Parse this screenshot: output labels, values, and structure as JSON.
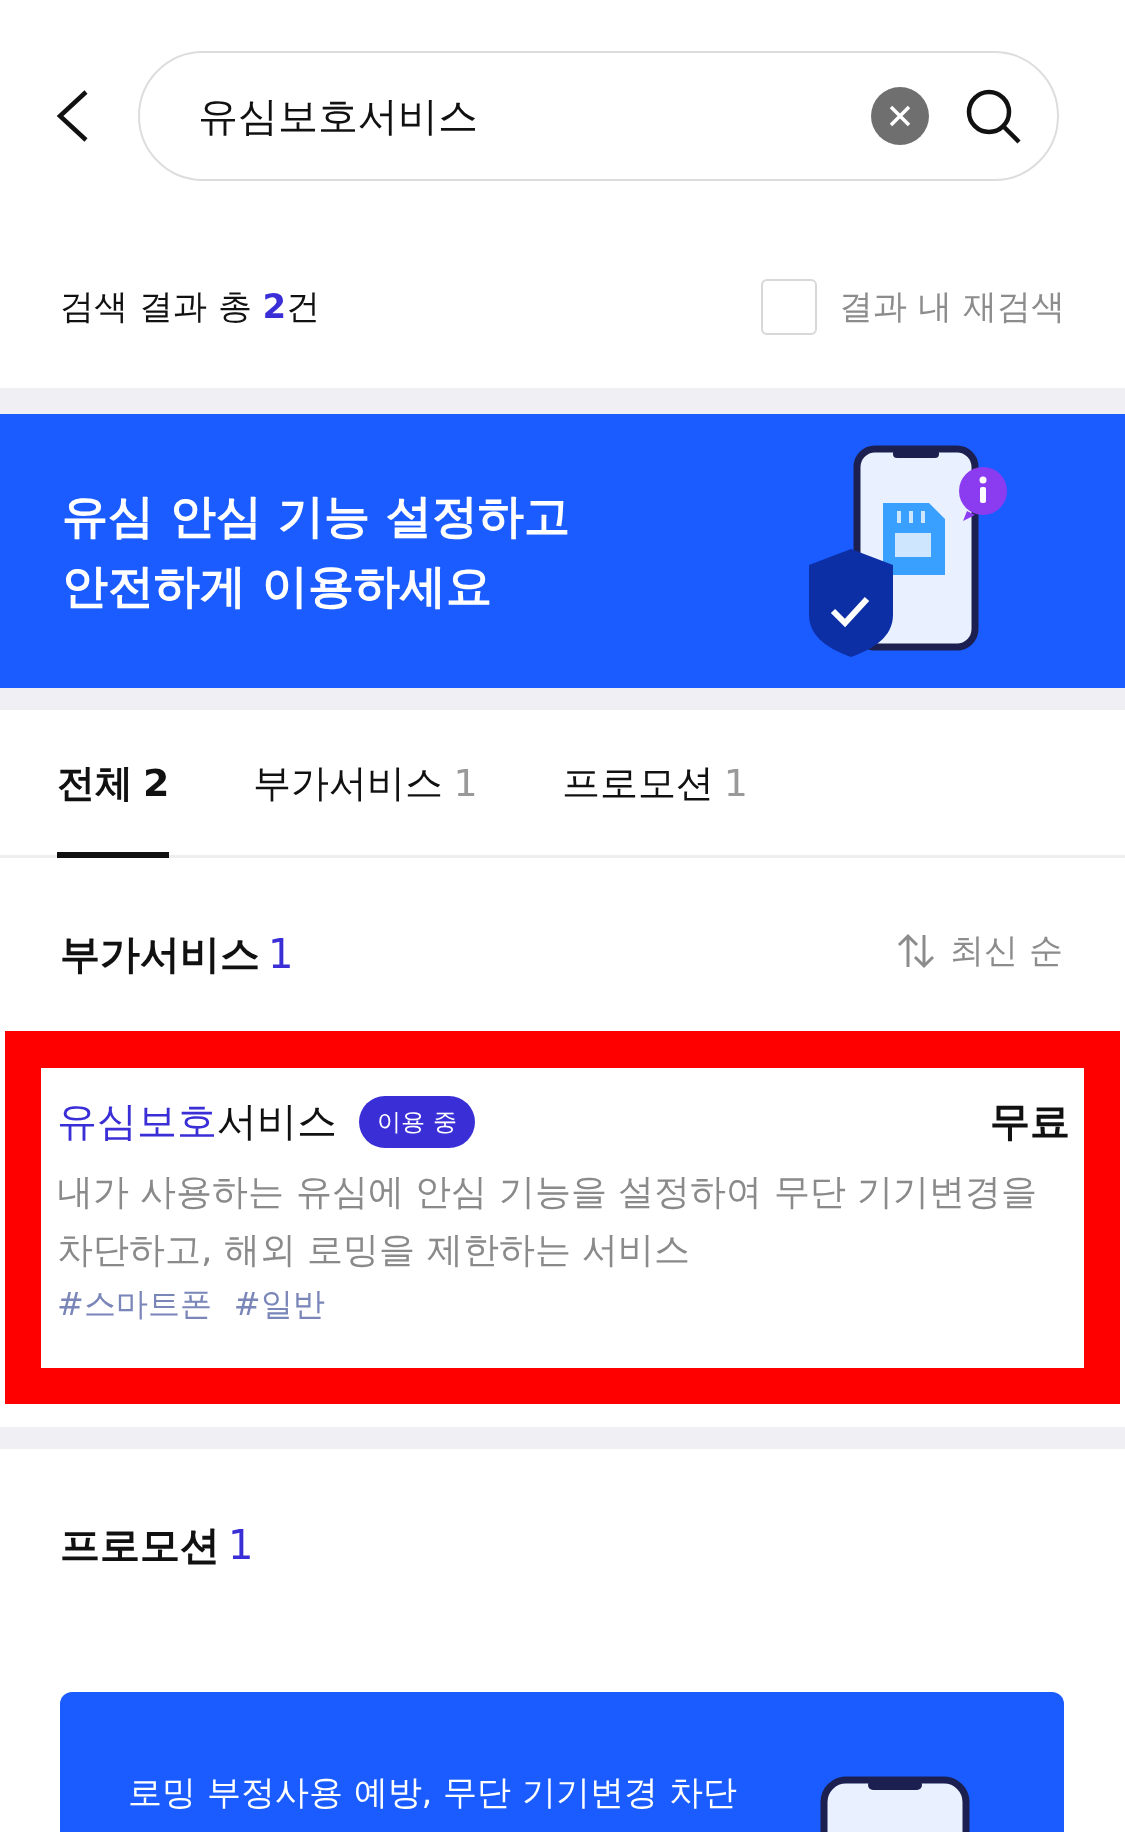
{
  "search": {
    "value": "유심보호서비스"
  },
  "result_summary": {
    "text": "검색 결과 총 **2**건"
  },
  "refine_search": {
    "label": "결과 내 재검색",
    "checked": false
  },
  "banner": {
    "lines": [
      "유심 안심 기능 설정하고",
      "안전하게 이용하세요"
    ]
  },
  "tabs": [
    {
      "label": "전체",
      "count": "2",
      "selected": true
    },
    {
      "label": "부가서비스",
      "count": "1",
      "selected": false
    },
    {
      "label": "프로모션",
      "count": "1",
      "selected": false
    }
  ],
  "sections": [
    {
      "kind": "services",
      "title": "부가서비스",
      "count": "1",
      "sort": "최신 순",
      "items": [
        {
          "name": "**유심보호**서비스",
          "badge": "이용 중",
          "price": "무료",
          "description": "내가 사용하는 유심에 안심 기능을 설정하여 무단 기기변경을 차단하고, 해외 로밍을 제한하는 서비스",
          "tags": [
            "#스마트폰",
            "#일반"
          ],
          "highlighted": true
        }
      ]
    },
    {
      "kind": "promotions",
      "title": "프로모션",
      "count": "1",
      "items": [
        {
          "text": "로밍 부정사용 예방, 무단 기기변경 차단"
        }
      ]
    }
  ]
}
